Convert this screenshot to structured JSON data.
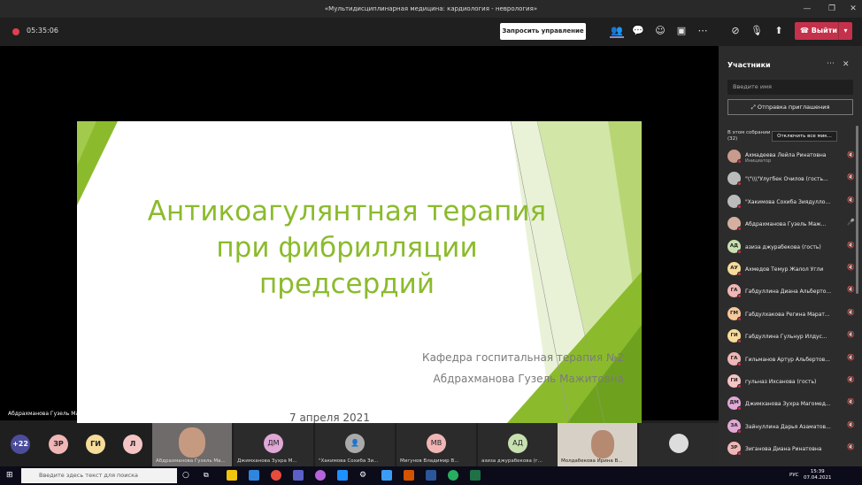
{
  "window": {
    "title": "«Мультидисциплинарная медицина: кардиология - неврология»"
  },
  "toolbar": {
    "timer": "05:35:06",
    "request_control": "Запросить управление",
    "leave": "Выйти"
  },
  "slide": {
    "title_lines": [
      "Антикоагулянтная терапия",
      "при фибрилляции",
      "предсердий"
    ],
    "department": "Кафедра госпитальная терапия №2",
    "author": "Абдрахманова Гузель Мажитовна",
    "date": "7 апреля 2021",
    "accent": "#8bbb2d"
  },
  "speaker_label": "Абдрахманова Гузель Мажитовна",
  "strip": {
    "more_count": "+22",
    "bubbles": [
      {
        "initials": "ЗР",
        "color": "#f0b6b6"
      },
      {
        "initials": "ГИ",
        "color": "#f6dc9a"
      },
      {
        "initials": "Л",
        "color": "#f5c4c4"
      }
    ],
    "tiles": [
      {
        "name": "Абдрахманова Гузель Ма...",
        "video": true
      },
      {
        "name": "Джимханова Зухра М...",
        "initials": "ДМ",
        "color": "#e0a8d6"
      },
      {
        "name": "\"Хакимова Сохиба Зи...",
        "initials": "",
        "color": "#aaaaaa"
      },
      {
        "name": "Мигунов Владимир В...",
        "initials": "МВ",
        "color": "#f0b6b6"
      },
      {
        "name": "азиза джурабекова (г...",
        "initials": "АД",
        "color": "#c7e0b0"
      },
      {
        "name": "Молдабекова Ирина В...",
        "video": true
      }
    ]
  },
  "panel": {
    "title": "Участники",
    "search_placeholder": "Введите имя",
    "invite": "Отправка приглашения",
    "section_label": "В этом собрании",
    "section_count": "(32)",
    "mute_all": "Отключить все мик...",
    "participants": [
      {
        "name": "Ахмадеева Лейла Ринатовна",
        "role": "Инициатор",
        "initials": "",
        "color": "#c89b8c",
        "photo": true
      },
      {
        "name": "\"\\\"\\\\\\\"Улугбек Очилов (гость...",
        "initials": "",
        "color": "#bbbbbb"
      },
      {
        "name": "\"Хакимова Сохиба Зиядулло...",
        "initials": "",
        "color": "#bbbbbb"
      },
      {
        "name": "Абдрахманова Гузель Маж...",
        "initials": "",
        "color": "#d5b0a0",
        "photo": true,
        "mic_on": true
      },
      {
        "name": "азиза джурабекова (гость)",
        "initials": "АД",
        "color": "#c7e0b0"
      },
      {
        "name": "Ахмедов Темур Жалол Угли",
        "initials": "АУ",
        "color": "#f6dc9a"
      },
      {
        "name": "Габдуллина Диана Альберто...",
        "initials": "ГА",
        "color": "#f0b6b6"
      },
      {
        "name": "Габдулхакова Регина Марат...",
        "initials": "ГМ",
        "color": "#f6c89a"
      },
      {
        "name": "Габдуллина Гульнур Илдус...",
        "initials": "ГИ",
        "color": "#f6dc9a"
      },
      {
        "name": "Гильманов Артур Альбертов...",
        "initials": "ГА",
        "color": "#f0b6b6"
      },
      {
        "name": "гульназ Ихсанова (гость)",
        "initials": "ГИ",
        "color": "#f5c4c4"
      },
      {
        "name": "Джимханова Зухра Магомед...",
        "initials": "ДМ",
        "color": "#e0a8d6"
      },
      {
        "name": "Зайнуллина Дарья Азаматов...",
        "initials": "ЗА",
        "color": "#e0a8d6"
      },
      {
        "name": "Зиганова Диана Ринатовна",
        "initials": "ЗР",
        "color": "#f0b6b6"
      }
    ]
  },
  "taskbar": {
    "search_placeholder": "Введите здесь текст для поиска",
    "lang": "РУС",
    "time": "15:39",
    "date": "07.04.2021"
  }
}
